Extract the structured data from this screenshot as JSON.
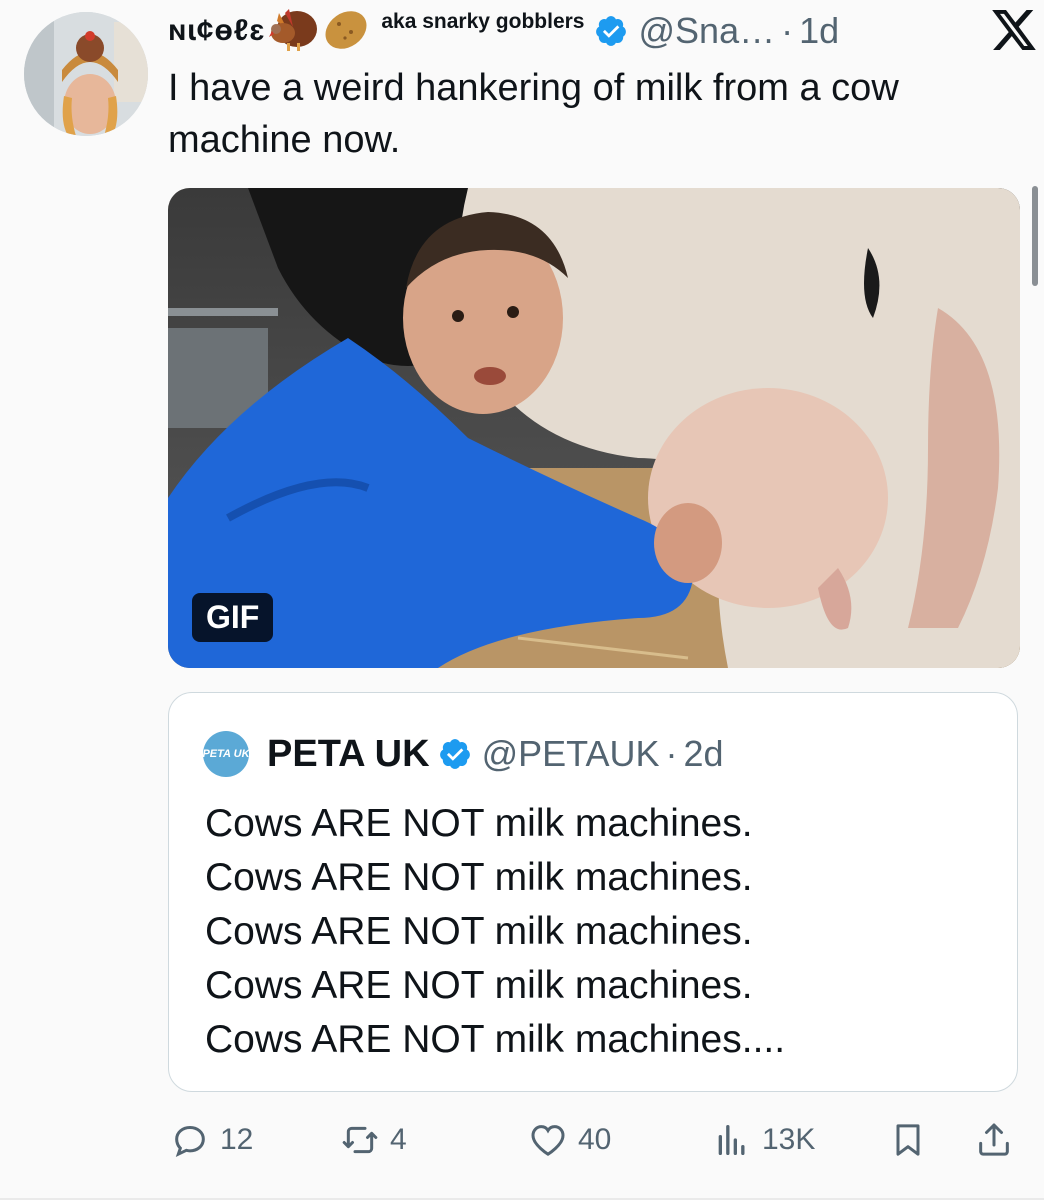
{
  "tweet": {
    "display_name": "ɴɩ¢ɵℓɛ",
    "emoji_1": "turkey-emoji",
    "emoji_2": "potato-emoji",
    "aka": "aka snarky gobblers",
    "handle": "@Sna…",
    "separator": "·",
    "time": "1d",
    "text": "I have a weird hankering of milk from a cow machine now.",
    "media": {
      "badge": "GIF"
    }
  },
  "quoted_tweet": {
    "avatar_text": "PETA UK",
    "name": "PETA UK",
    "handle": "@PETAUK",
    "separator": "·",
    "time": "2d",
    "lines": [
      "Cows ARE NOT milk machines.",
      "Cows ARE NOT milk machines.",
      "Cows ARE NOT milk machines.",
      "Cows ARE NOT milk machines.",
      "Cows ARE NOT milk machines...."
    ]
  },
  "actions": {
    "reply_count": "12",
    "retweet_count": "4",
    "like_count": "40",
    "views_count": "13K"
  },
  "colors": {
    "verified": "#1d9bf0",
    "secondary_text": "#536471",
    "gif_jacket": "#1f67d8"
  },
  "icons": [
    "x-logo-icon",
    "verified-badge-icon",
    "reply-icon",
    "retweet-icon",
    "like-icon",
    "views-icon",
    "bookmark-icon",
    "share-icon"
  ]
}
